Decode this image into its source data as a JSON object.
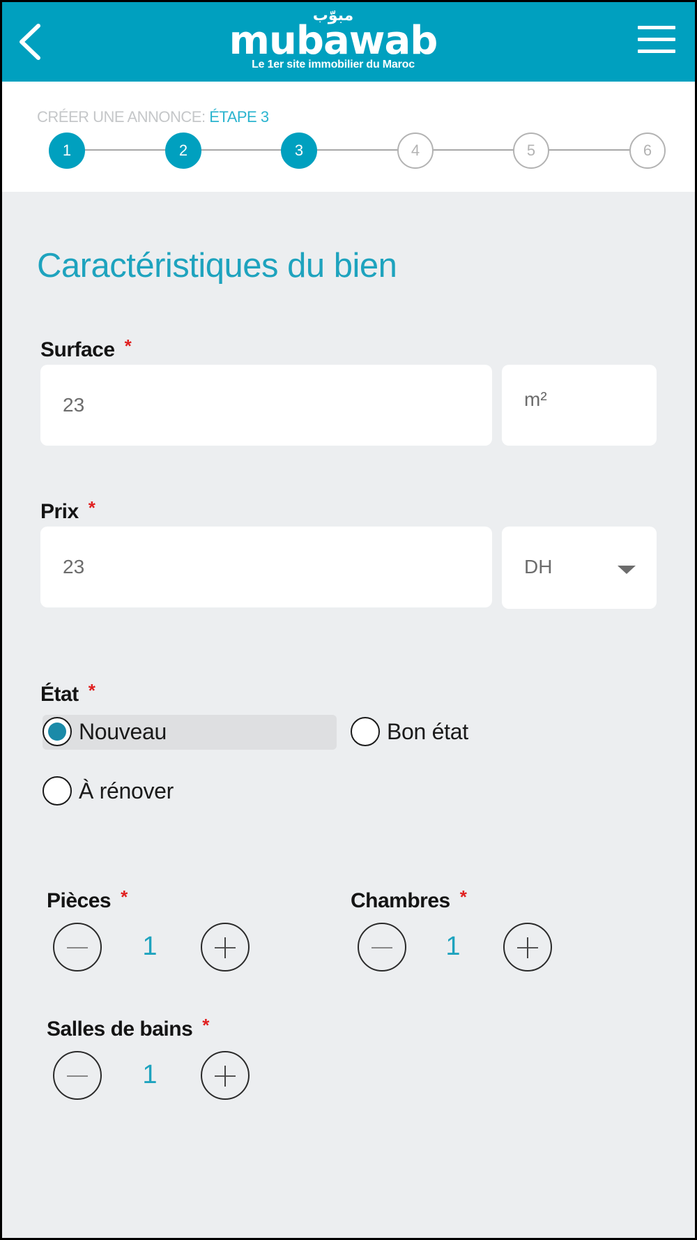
{
  "header": {
    "logo_arabic": "مبوّب",
    "logo_brand": "mubawab",
    "tagline": "Le 1er site immobilier du Maroc"
  },
  "stepper": {
    "prefix": "CRÉER UNE ANNONCE:",
    "current_label": "ÉTAPE 3",
    "current": 3,
    "steps": [
      "1",
      "2",
      "3",
      "4",
      "5",
      "6"
    ]
  },
  "form": {
    "title": "Caractéristiques du bien",
    "required_mark": "*",
    "surface": {
      "label": "Surface",
      "value": "23",
      "unit": "m²"
    },
    "prix": {
      "label": "Prix",
      "value": "23",
      "currency": "DH"
    },
    "etat": {
      "label": "État",
      "options": [
        "Nouveau",
        "Bon état",
        "À rénover"
      ],
      "selected": "Nouveau"
    },
    "pieces": {
      "label": "Pièces",
      "value": "1"
    },
    "chambres": {
      "label": "Chambres",
      "value": "1"
    },
    "salles_de_bains": {
      "label": "Salles de bains",
      "value": "1"
    }
  },
  "colors": {
    "brand": "#00a0bf",
    "accent_text": "#1ea3be",
    "required": "#e02020",
    "background": "#eceef0"
  }
}
